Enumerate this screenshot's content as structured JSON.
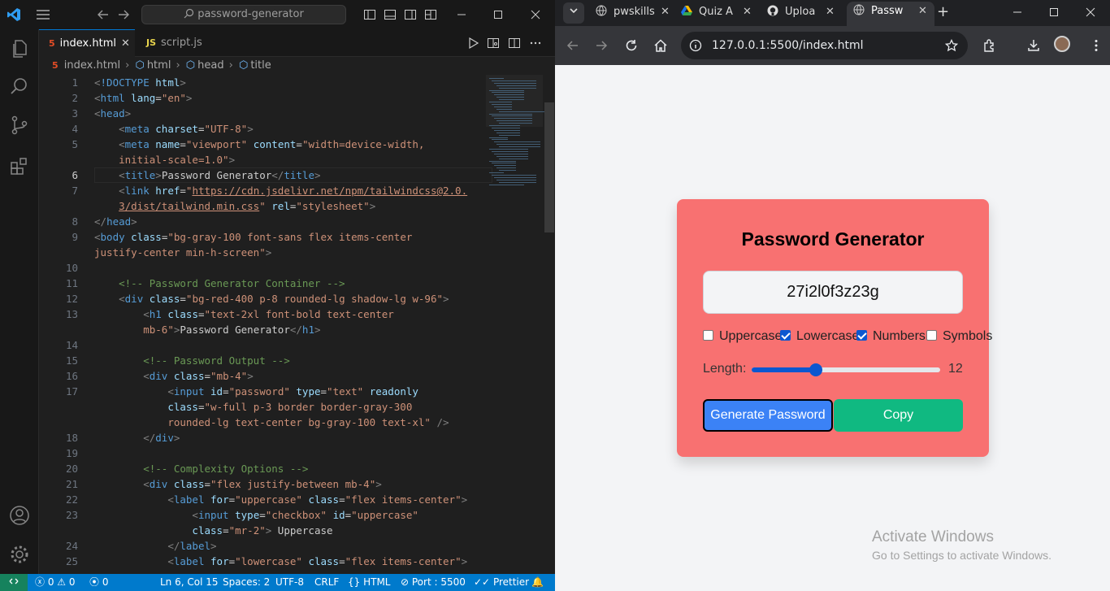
{
  "vscode": {
    "command_center": "password-generator",
    "tabs": [
      {
        "icon": "5",
        "label": "index.html",
        "active": true
      },
      {
        "icon": "JS",
        "label": "script.js",
        "active": false
      }
    ],
    "breadcrumb": [
      "index.html",
      "html",
      "head",
      "title"
    ],
    "code": [
      {
        "n": "1",
        "html": "<span style='color:#808080'>&lt;</span><span style='color:#569cd6'>!DOCTYPE</span> <span style='color:#9cdcfe'>html</span><span style='color:#808080'>&gt;</span>"
      },
      {
        "n": "2",
        "html": "<span style='color:#808080'>&lt;</span><span style='color:#569cd6'>html</span> <span style='color:#9cdcfe'>lang</span>=<span style='color:#ce9178'>\"en\"</span><span style='color:#808080'>&gt;</span>"
      },
      {
        "n": "3",
        "html": "<span style='color:#808080'>&lt;</span><span style='color:#569cd6'>head</span><span style='color:#808080'>&gt;</span>"
      },
      {
        "n": "4",
        "html": "    <span style='color:#808080'>&lt;</span><span style='color:#569cd6'>meta</span> <span style='color:#9cdcfe'>charset</span>=<span style='color:#ce9178'>\"UTF-8\"</span><span style='color:#808080'>&gt;</span>"
      },
      {
        "n": "5",
        "html": "    <span style='color:#808080'>&lt;</span><span style='color:#569cd6'>meta</span> <span style='color:#9cdcfe'>name</span>=<span style='color:#ce9178'>\"viewport\"</span> <span style='color:#9cdcfe'>content</span>=<span style='color:#ce9178'>\"width=device-width,</span>"
      },
      {
        "n": "",
        "html": "    <span style='color:#ce9178'>initial-scale=1.0\"</span><span style='color:#808080'>&gt;</span>"
      },
      {
        "n": "6",
        "html": "    <span style='color:#808080'>&lt;</span><span style='color:#569cd6'>title</span><span style='color:#808080'>&gt;</span>Password Generator<span style='color:#808080'>&lt;/</span><span style='color:#569cd6'>title</span><span style='color:#808080'>&gt;</span>"
      },
      {
        "n": "7",
        "html": "    <span style='color:#808080'>&lt;</span><span style='color:#569cd6'>link</span> <span style='color:#9cdcfe'>href</span>=<span style='color:#ce9178'>\"<u>https://cdn.jsdelivr.net/npm/tailwindcss@2.0.</u></span>"
      },
      {
        "n": "",
        "html": "    <span style='color:#ce9178'><u>3/dist/tailwind.min.css</u>\"</span> <span style='color:#9cdcfe'>rel</span>=<span style='color:#ce9178'>\"stylesheet\"</span><span style='color:#808080'>&gt;</span>"
      },
      {
        "n": "8",
        "html": "<span style='color:#808080'>&lt;/</span><span style='color:#569cd6'>head</span><span style='color:#808080'>&gt;</span>"
      },
      {
        "n": "9",
        "html": "<span style='color:#808080'>&lt;</span><span style='color:#569cd6'>body</span> <span style='color:#9cdcfe'>class</span>=<span style='color:#ce9178'>\"bg-gray-100 font-sans flex items-center</span>"
      },
      {
        "n": "",
        "html": "<span style='color:#ce9178'>justify-center min-h-screen\"</span><span style='color:#808080'>&gt;</span>"
      },
      {
        "n": "10",
        "html": ""
      },
      {
        "n": "11",
        "html": "    <span style='color:#6a9955'>&lt;!-- Password Generator Container --&gt;</span>"
      },
      {
        "n": "12",
        "html": "    <span style='color:#808080'>&lt;</span><span style='color:#569cd6'>div</span> <span style='color:#9cdcfe'>class</span>=<span style='color:#ce9178'>\"bg-red-400 p-8 rounded-lg shadow-lg w-96\"</span><span style='color:#808080'>&gt;</span>"
      },
      {
        "n": "13",
        "html": "        <span style='color:#808080'>&lt;</span><span style='color:#569cd6'>h1</span> <span style='color:#9cdcfe'>class</span>=<span style='color:#ce9178'>\"text-2xl font-bold text-center</span>"
      },
      {
        "n": "",
        "html": "        <span style='color:#ce9178'>mb-6\"</span><span style='color:#808080'>&gt;</span>Password Generator<span style='color:#808080'>&lt;/</span><span style='color:#569cd6'>h1</span><span style='color:#808080'>&gt;</span>"
      },
      {
        "n": "14",
        "html": ""
      },
      {
        "n": "15",
        "html": "        <span style='color:#6a9955'>&lt;!-- Password Output --&gt;</span>"
      },
      {
        "n": "16",
        "html": "        <span style='color:#808080'>&lt;</span><span style='color:#569cd6'>div</span> <span style='color:#9cdcfe'>class</span>=<span style='color:#ce9178'>\"mb-4\"</span><span style='color:#808080'>&gt;</span>"
      },
      {
        "n": "17",
        "html": "            <span style='color:#808080'>&lt;</span><span style='color:#569cd6'>input</span> <span style='color:#9cdcfe'>id</span>=<span style='color:#ce9178'>\"password\"</span> <span style='color:#9cdcfe'>type</span>=<span style='color:#ce9178'>\"text\"</span> <span style='color:#9cdcfe'>readonly</span>"
      },
      {
        "n": "",
        "html": "            <span style='color:#9cdcfe'>class</span>=<span style='color:#ce9178'>\"w-full p-3 border border-gray-300</span>"
      },
      {
        "n": "",
        "html": "            <span style='color:#ce9178'>rounded-lg text-center bg-gray-100 text-xl\"</span> <span style='color:#808080'>/&gt;</span>"
      },
      {
        "n": "18",
        "html": "        <span style='color:#808080'>&lt;/</span><span style='color:#569cd6'>div</span><span style='color:#808080'>&gt;</span>"
      },
      {
        "n": "19",
        "html": ""
      },
      {
        "n": "20",
        "html": "        <span style='color:#6a9955'>&lt;!-- Complexity Options --&gt;</span>"
      },
      {
        "n": "21",
        "html": "        <span style='color:#808080'>&lt;</span><span style='color:#569cd6'>div</span> <span style='color:#9cdcfe'>class</span>=<span style='color:#ce9178'>\"flex justify-between mb-4\"</span><span style='color:#808080'>&gt;</span>"
      },
      {
        "n": "22",
        "html": "            <span style='color:#808080'>&lt;</span><span style='color:#569cd6'>label</span> <span style='color:#9cdcfe'>for</span>=<span style='color:#ce9178'>\"uppercase\"</span> <span style='color:#9cdcfe'>class</span>=<span style='color:#ce9178'>\"flex items-center\"</span><span style='color:#808080'>&gt;</span>"
      },
      {
        "n": "23",
        "html": "                <span style='color:#808080'>&lt;</span><span style='color:#569cd6'>input</span> <span style='color:#9cdcfe'>type</span>=<span style='color:#ce9178'>\"checkbox\"</span> <span style='color:#9cdcfe'>id</span>=<span style='color:#ce9178'>\"uppercase\"</span>"
      },
      {
        "n": "",
        "html": "                <span style='color:#9cdcfe'>class</span>=<span style='color:#ce9178'>\"mr-2\"</span><span style='color:#808080'>&gt;</span> Uppercase"
      },
      {
        "n": "24",
        "html": "            <span style='color:#808080'>&lt;/</span><span style='color:#569cd6'>label</span><span style='color:#808080'>&gt;</span>"
      },
      {
        "n": "25",
        "html": "            <span style='color:#808080'>&lt;</span><span style='color:#569cd6'>label</span> <span style='color:#9cdcfe'>for</span>=<span style='color:#ce9178'>\"lowercase\"</span> <span style='color:#9cdcfe'>class</span>=<span style='color:#ce9178'>\"flex items-center\"</span><span style='color:#808080'>&gt;</span>"
      }
    ],
    "status": {
      "errors": "0",
      "warnings": "0",
      "ports": "0",
      "position": "Ln 6, Col 15",
      "spaces": "Spaces: 2",
      "encoding": "UTF-8",
      "eol": "CRLF",
      "language": "HTML",
      "port": "Port : 5500",
      "formatter": "Prettier"
    }
  },
  "chrome": {
    "tabs": [
      {
        "label": "pwskills",
        "icon": "globe-icon"
      },
      {
        "label": "Quiz A",
        "icon": "drive-icon"
      },
      {
        "label": "Uploa",
        "icon": "github-icon"
      },
      {
        "label": "Passw",
        "icon": "globe-icon",
        "active": true
      }
    ],
    "url": "127.0.0.1:5500/index.html"
  },
  "app": {
    "title": "Password Generator",
    "password": "27i2l0f3z23g",
    "options": [
      {
        "label": "Uppercase",
        "checked": false
      },
      {
        "label": "Lowercase",
        "checked": true
      },
      {
        "label": "Numbers",
        "checked": true
      },
      {
        "label": "Symbols",
        "checked": false
      }
    ],
    "length_label": "Length:",
    "length_value": "12",
    "slider_fraction": 0.34,
    "generate_label": "Generate Password",
    "copy_label": "Copy"
  },
  "watermark": {
    "line1": "Activate Windows",
    "line2": "Go to Settings to activate Windows."
  }
}
